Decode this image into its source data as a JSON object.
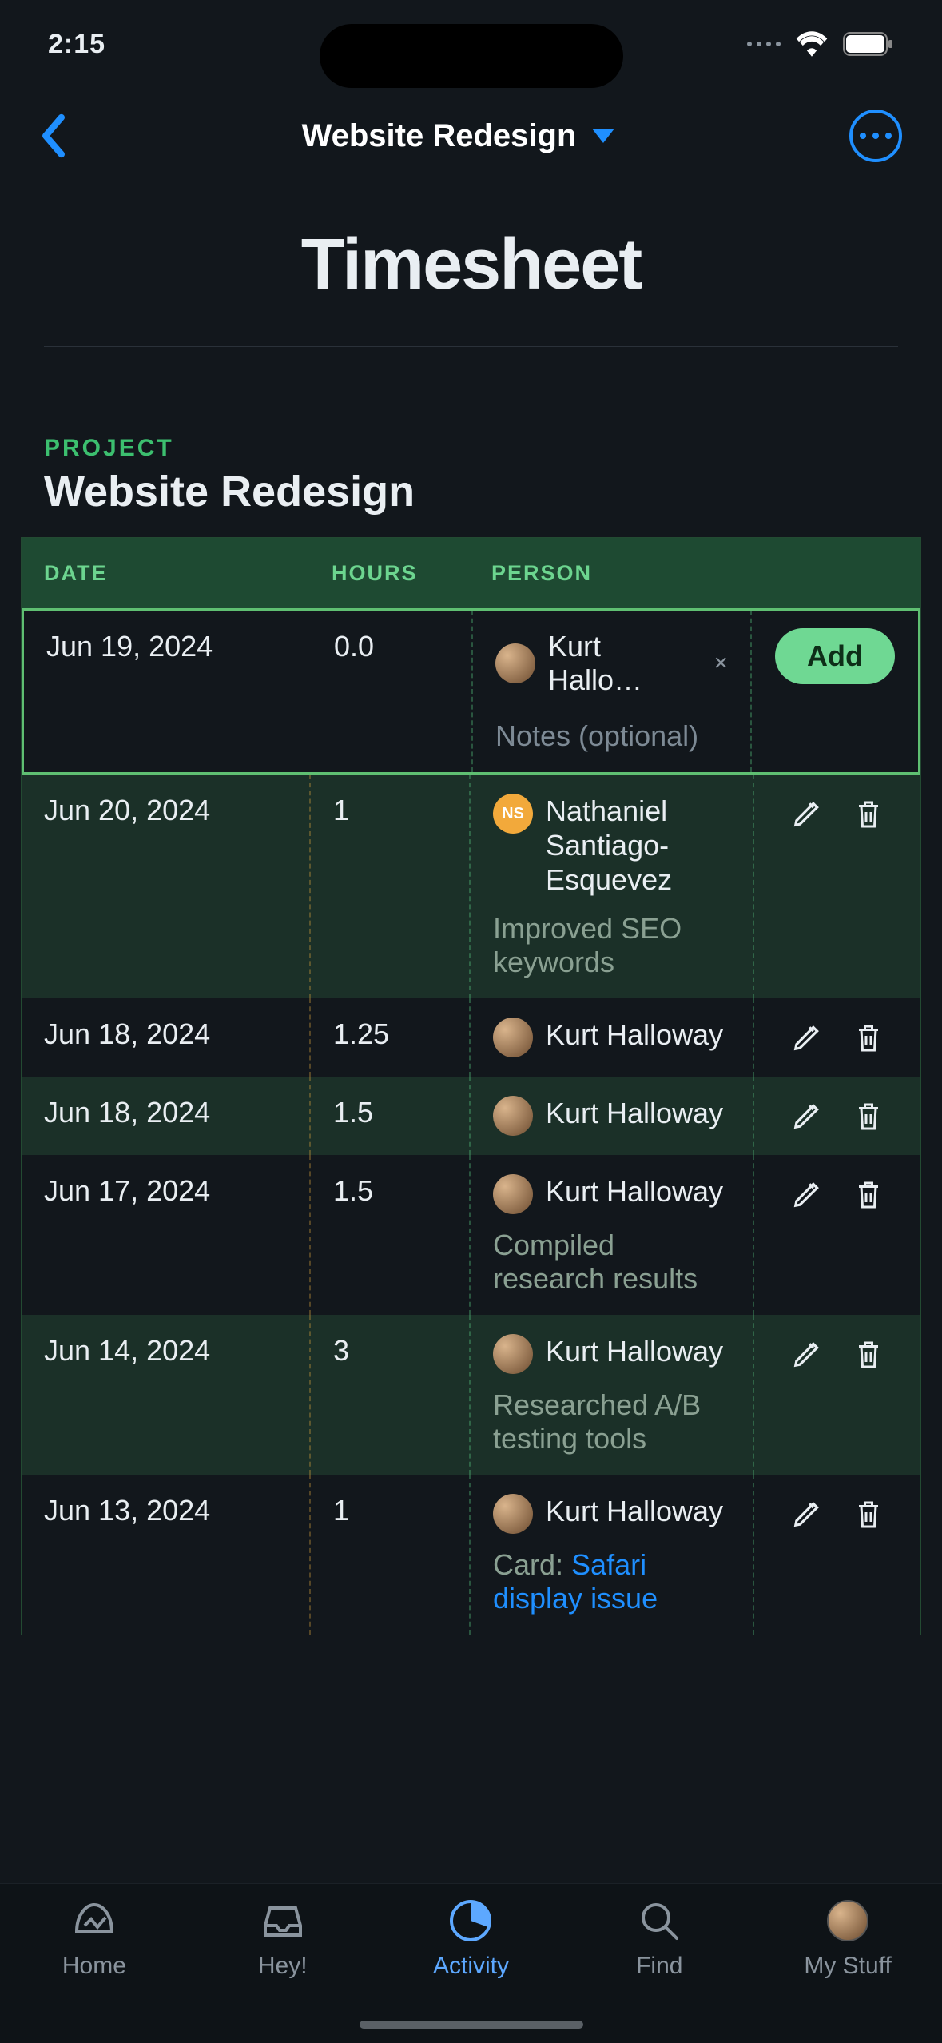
{
  "status": {
    "time": "2:15"
  },
  "nav": {
    "project_title": "Website Redesign"
  },
  "page": {
    "title": "Timesheet"
  },
  "section": {
    "label": "PROJECT",
    "project": "Website Redesign"
  },
  "columns": {
    "date": "DATE",
    "hours": "HOURS",
    "person": "PERSON"
  },
  "new_entry": {
    "date": "Jun 19, 2024",
    "hours": "0.0",
    "person": "Kurt Hallo…",
    "notes_placeholder": "Notes (optional)",
    "add_label": "Add"
  },
  "entries": [
    {
      "date": "Jun 20, 2024",
      "hours": "1",
      "person": "Nathaniel Santiago-Esquevez",
      "initials": "NS",
      "notes": "Improved SEO keywords"
    },
    {
      "date": "Jun 18, 2024",
      "hours": "1.25",
      "person": "Kurt Halloway",
      "notes": ""
    },
    {
      "date": "Jun 18, 2024",
      "hours": "1.5",
      "person": "Kurt Halloway",
      "notes": ""
    },
    {
      "date": "Jun 17, 2024",
      "hours": "1.5",
      "person": "Kurt Halloway",
      "notes": "Compiled research results"
    },
    {
      "date": "Jun 14, 2024",
      "hours": "3",
      "person": "Kurt Halloway",
      "notes": "Researched A/B testing tools"
    },
    {
      "date": "Jun 13, 2024",
      "hours": "1",
      "person": "Kurt Halloway",
      "notes_prefix": "Card: ",
      "notes_link": "Safari display issue"
    }
  ],
  "tabbar": {
    "home": "Home",
    "hey": "Hey!",
    "activity": "Activity",
    "find": "Find",
    "mystuff": "My Stuff"
  }
}
